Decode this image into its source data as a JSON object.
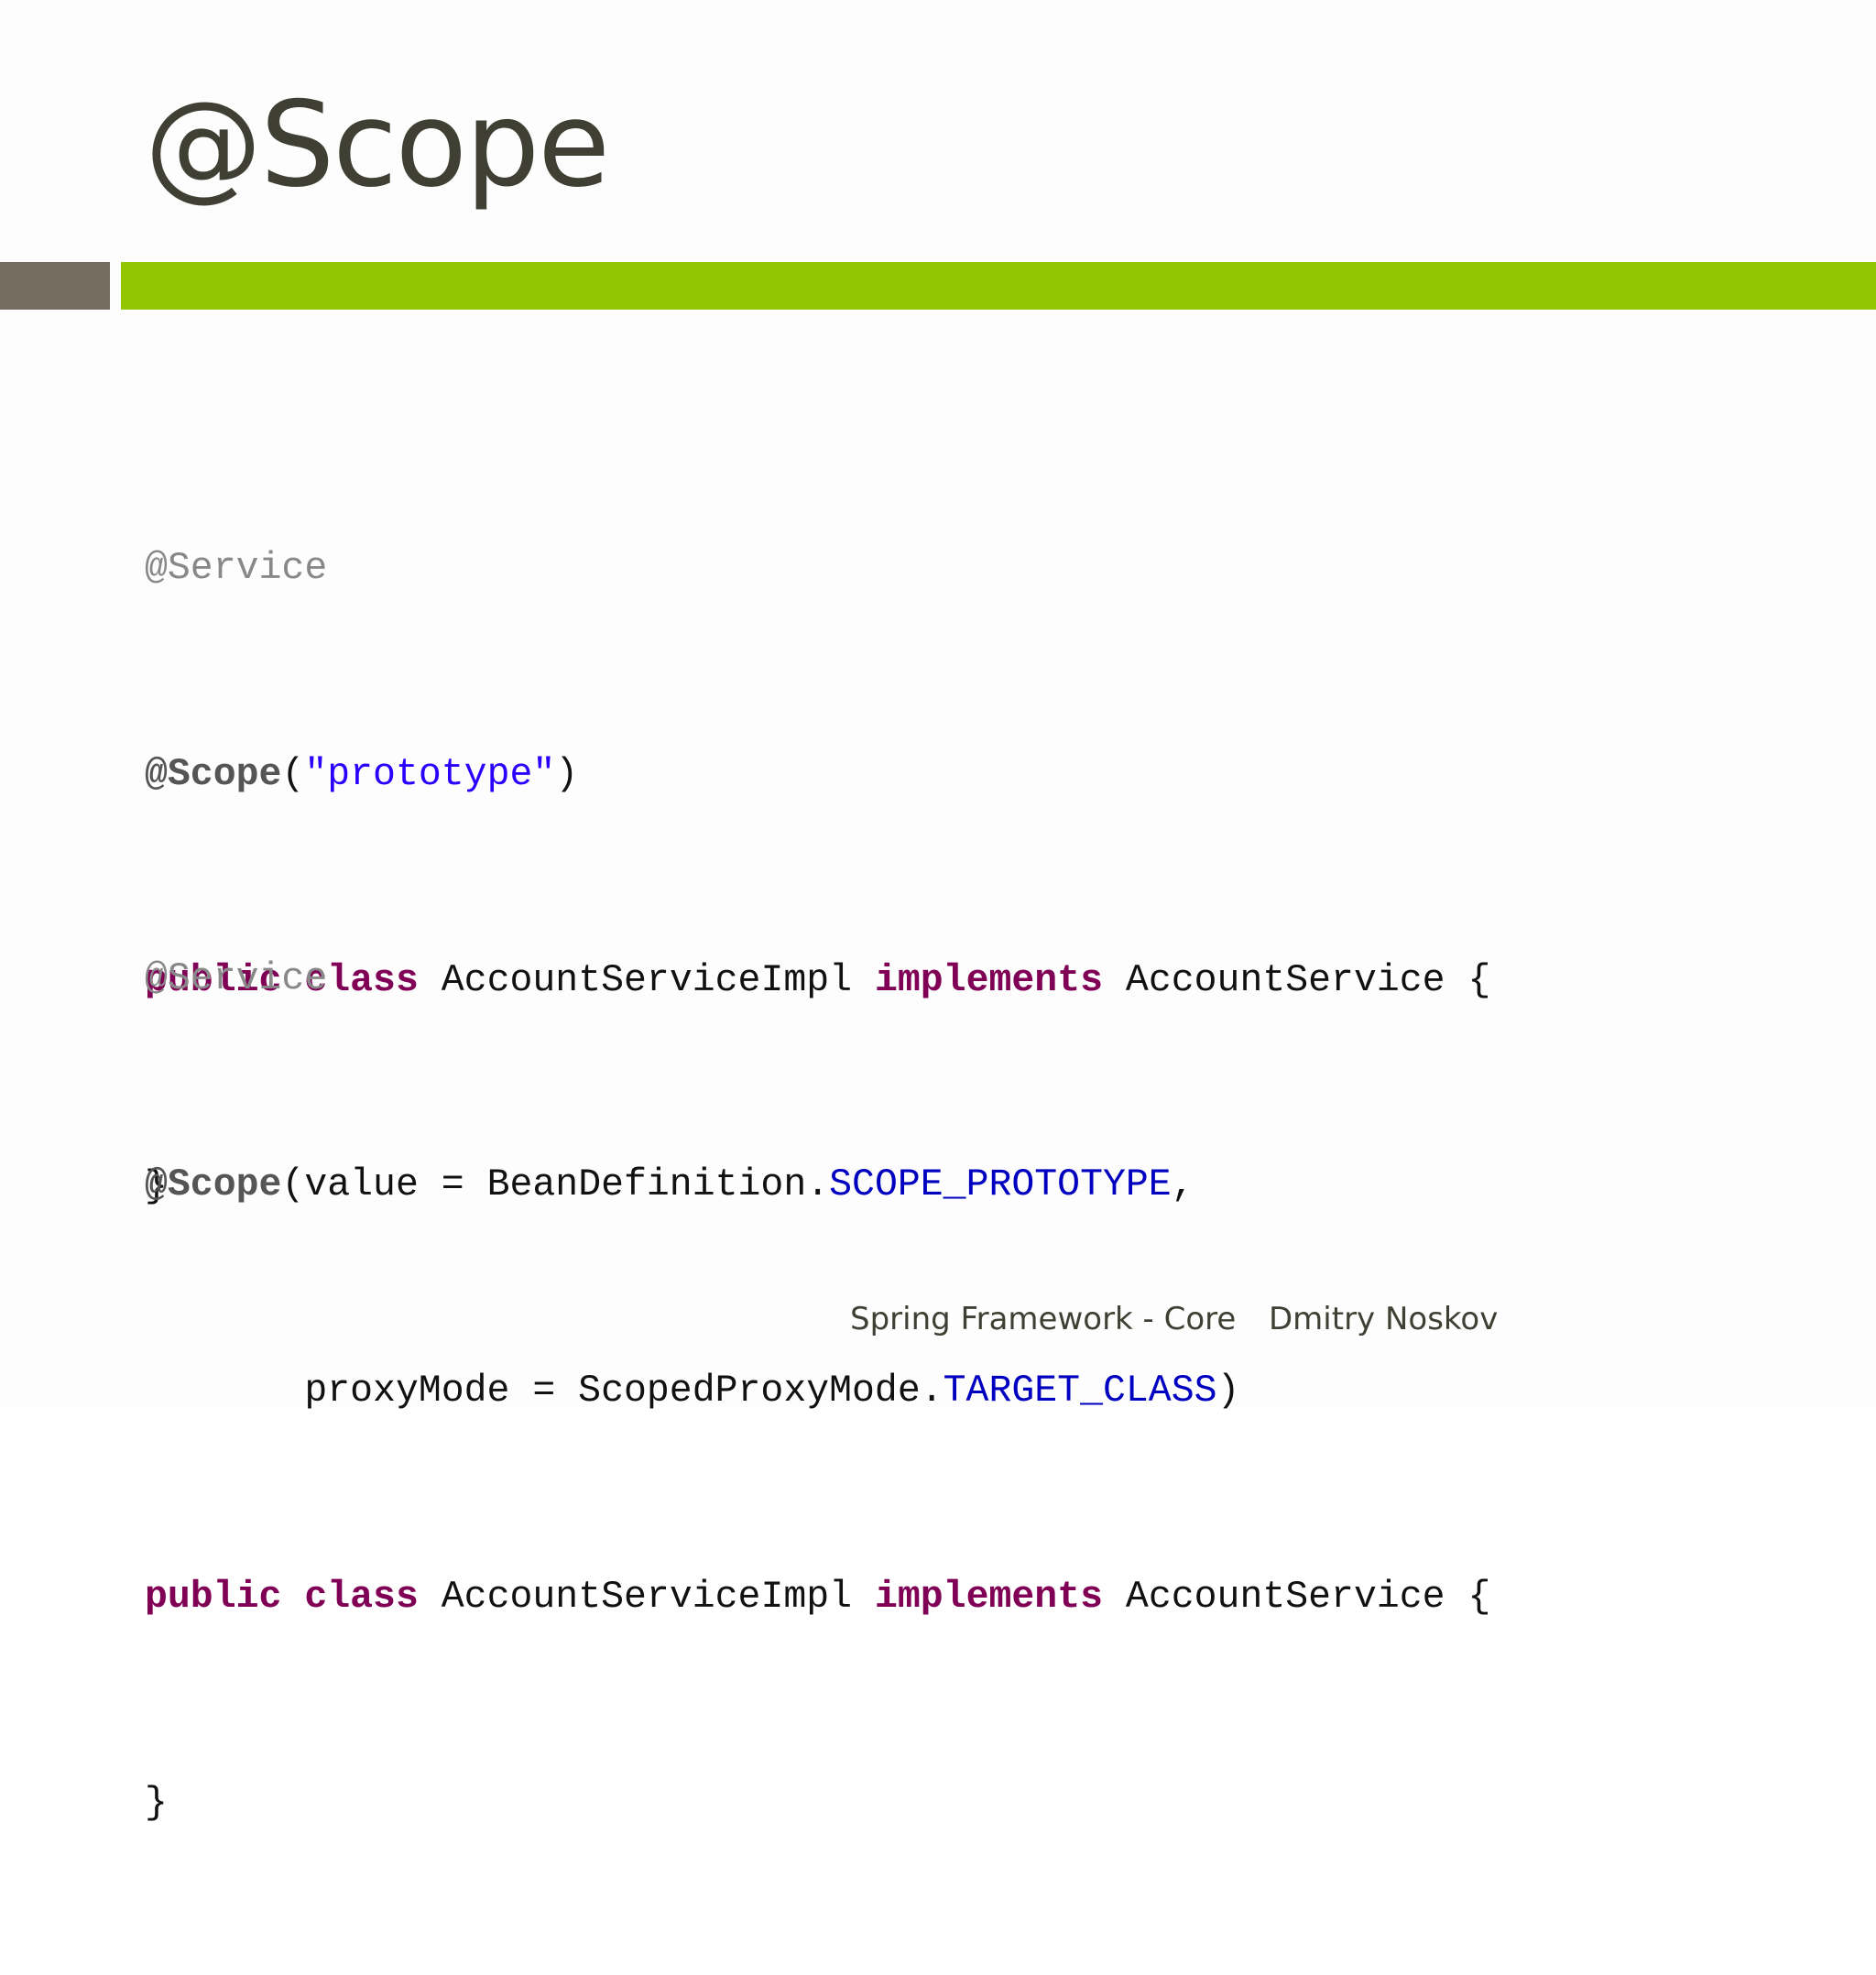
{
  "slide": {
    "title": "@Scope"
  },
  "code_block_1": {
    "line1": {
      "ann": "@Service"
    },
    "line2": {
      "ann": "@Scope",
      "p1": "(",
      "str": "\"prototype\"",
      "p2": ")"
    },
    "line3": {
      "kw1": "public",
      "kw2": "class",
      "name": "AccountServiceImpl",
      "kw3": "implements",
      "iface": "AccountService {"
    },
    "line4": {
      "text": "}"
    }
  },
  "code_block_2": {
    "line1": {
      "ann": "@Service"
    },
    "line2": {
      "ann": "@Scope",
      "p1": "(value = BeanDefinition.",
      "const": "SCOPE_PROTOTYPE",
      "p2": ","
    },
    "line3": {
      "p1": "       proxyMode = ScopedProxyMode.",
      "const": "TARGET_CLASS",
      "p2": ")"
    },
    "line4": {
      "kw1": "public",
      "kw2": "class",
      "name": "AccountServiceImpl",
      "kw3": "implements",
      "iface": "AccountService {"
    },
    "line5": {
      "text": "}"
    }
  },
  "footer": {
    "course": "Spring Framework - Core",
    "author": "Dmitry Noskov"
  },
  "colors": {
    "title": "#3f4033",
    "accent_green": "#93c600",
    "accent_grey": "#756e60",
    "keyword": "#7f0055",
    "string": "#2a00ff",
    "constant": "#0000c0",
    "annotation": "#888888"
  }
}
